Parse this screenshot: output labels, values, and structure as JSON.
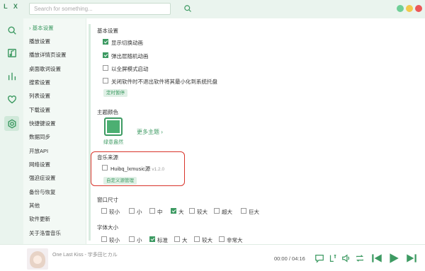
{
  "app": {
    "logo": "L X"
  },
  "search": {
    "placeholder": "Search for something..."
  },
  "colors": {
    "accent": "#3d9a62",
    "highlight": "#d9342b",
    "rail_bg": "#eaf4ee"
  },
  "rail": {
    "icons": [
      "search-icon",
      "music-list-icon",
      "chart-icon",
      "heart-icon",
      "settings-icon"
    ]
  },
  "nav": {
    "items": [
      "基本设置",
      "播放设置",
      "播放详情页设置",
      "桌面歌词设置",
      "搜索设置",
      "列表设置",
      "下载设置",
      "快捷键设置",
      "数据同步",
      "开放API",
      "网络设置",
      "强迫症设置",
      "备份与恢复",
      "其他",
      "软件更新",
      "关于洛雪音乐"
    ]
  },
  "basic": {
    "title": "基本设置",
    "options": [
      {
        "label": "显示切换动画",
        "checked": true
      },
      {
        "label": "弹出层随机动画",
        "checked": true
      },
      {
        "label": "以全屏模式启动",
        "checked": false
      },
      {
        "label": "关闭软件时不退出软件将其最小化到系统托盘",
        "checked": false
      }
    ],
    "timer_button": "定时暂停"
  },
  "theme": {
    "title": "主题颜色",
    "current": "绿意盎然",
    "more": "更多主题"
  },
  "source": {
    "title": "音乐来源",
    "name": "Huibq_lxmusic源",
    "version": "v1.2.0",
    "checked": false,
    "manage_button": "自定义源管理"
  },
  "window_size": {
    "title": "窗口尺寸",
    "options": [
      {
        "label": "较小",
        "checked": false
      },
      {
        "label": "小",
        "checked": false
      },
      {
        "label": "中",
        "checked": false
      },
      {
        "label": "大",
        "checked": true
      },
      {
        "label": "较大",
        "checked": false
      },
      {
        "label": "超大",
        "checked": false
      },
      {
        "label": "巨大",
        "checked": false
      }
    ]
  },
  "font_size": {
    "title": "字体大小",
    "options": [
      {
        "label": "较小",
        "checked": false
      },
      {
        "label": "小",
        "checked": false
      },
      {
        "label": "标准",
        "checked": true
      },
      {
        "label": "大",
        "checked": false
      },
      {
        "label": "较大",
        "checked": false
      },
      {
        "label": "非常大",
        "checked": false
      }
    ]
  },
  "player": {
    "song": "One Last Kiss - 宇多田ヒカル",
    "time": "00:00 / 04:16"
  }
}
